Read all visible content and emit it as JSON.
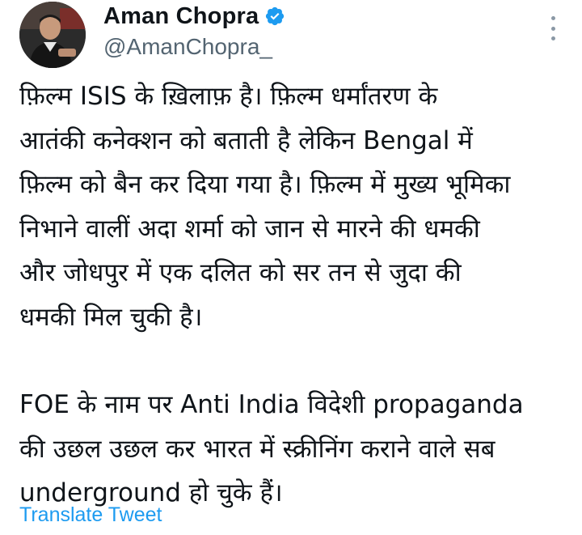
{
  "author": {
    "display_name": "Aman Chopra",
    "handle": "@AmanChopra_",
    "verified_icon": "verified-badge-icon",
    "avatar_icon": "profile-photo"
  },
  "menu": {
    "icon": "more-vertical-icon"
  },
  "tweet": {
    "paragraph1": [
      "फ़िल्म ISIS के ख़िलाफ़ है। फ़िल्म धर्मांतरण के",
      "आतंकी कनेक्शन को बताती है लेकिन Bengal में",
      "फ़िल्म को बैन कर दिया गया है। फ़िल्म में मुख्य भूमिका",
      "निभाने वालीं अदा शर्मा को जान से मारने की धमकी",
      "और जोधपुर में एक दलित को सर तन से जुदा की",
      "धमकी मिल चुकी है।"
    ],
    "paragraph2": [
      "FOE के नाम पर Anti India विदेशी propaganda",
      "की उछल उछल कर भारत में स्क्रीनिंग कराने वाले सब",
      "underground हो चुके हैं।"
    ]
  },
  "actions": {
    "translate_label": "Translate Tweet"
  },
  "colors": {
    "text": "#0f1419",
    "secondary": "#536471",
    "link": "#1d9bf0",
    "verified": "#1d9bf0"
  }
}
